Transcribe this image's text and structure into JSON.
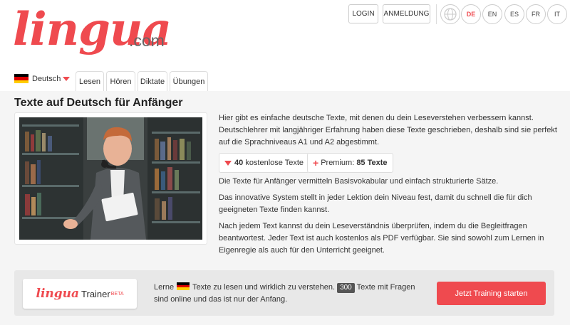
{
  "brand": {
    "logo": "lingua",
    "suffix": ".com",
    "accent": "#ef4a4f"
  },
  "auth": {
    "login": "LOGIN",
    "register": "ANMELDUNG"
  },
  "languages": [
    "DE",
    "EN",
    "ES",
    "FR",
    "IT"
  ],
  "active_language": "DE",
  "nav": {
    "language_label": "Deutsch",
    "tabs": [
      "Lesen",
      "Hören",
      "Diktate",
      "Übungen"
    ]
  },
  "main": {
    "title": "Texte auf Deutsch für Anfänger",
    "intro": "Hier gibt es einfache deutsche Texte, mit denen du dein Leseverstehen verbessern kannst. Deutschlehrer mit langjähriger Erfahrung haben diese Texte geschrieben, deshalb sind sie perfekt auf die Sprachniveaus A1 und A2 abgestimmt.",
    "free_count": "40",
    "free_label": "kostenlose Texte",
    "premium_label": "Premium:",
    "premium_count": "85 Texte",
    "p2": "Die Texte für Anfänger vermitteln Basisvokabular und einfach strukturierte Sätze.",
    "p3": "Das innovative System stellt in jeder Lektion dein Niveau fest, damit du schnell die für dich geeigneten Texte finden kannst.",
    "p4": "Nach jedem Text kannst du dein Leseverständnis überprüfen, indem du die Begleitfragen beantwortest. Jeder Text ist auch kostenlos als PDF verfügbar. Sie sind sowohl zum Lernen in Eigenregie als auch für den Unterricht geeignet."
  },
  "trainer": {
    "logo_brand": "lingua",
    "logo_word": "Trainer",
    "beta": "BETA",
    "text_a": "Lerne",
    "text_b": "Texte zu lesen und wirklich zu verstehen.",
    "count": "300",
    "text_c": "Texte mit Fragen",
    "text_d": "sind online und das ist nur der Anfang.",
    "cta": "Jetzt Training starten"
  }
}
